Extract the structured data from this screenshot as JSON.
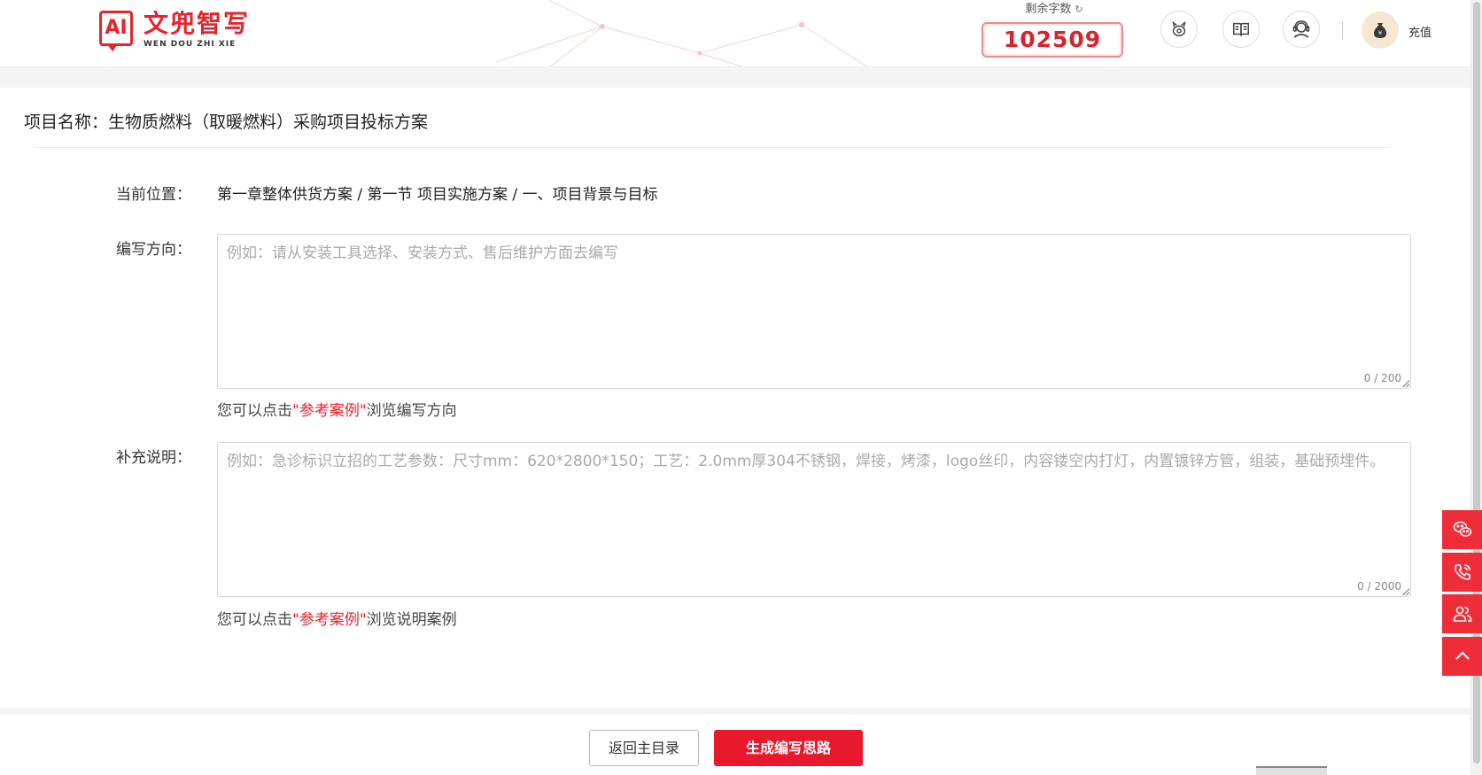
{
  "header": {
    "logo_mark": "AI",
    "logo_cn": "文兜智写",
    "logo_en": "WEN DOU ZHI XIE",
    "remaining_label": "剩余字数",
    "remaining_count": "102509",
    "recharge_label": "充值",
    "icons": [
      "piggy-bank-icon",
      "book-icon",
      "customer-service-icon",
      "money-bag-icon"
    ],
    "brand_color": "#e8232c"
  },
  "project": {
    "title": "项目名称：生物质燃料（取暖燃料）采购项目投标方案"
  },
  "form": {
    "location_label": "当前位置：",
    "location_value": "第一章整体供货方案 / 第一节 项目实施方案 / 一、项目背景与目标",
    "direction_label": "编写方向：",
    "direction_placeholder": "例如：请从安装工具选择、安装方式、售后维护方面去编写",
    "direction_counter": "0 / 200",
    "direction_hint_prefix": "您可以点击",
    "direction_hint_link": "\"参考案例\"",
    "direction_hint_suffix": "浏览编写方向",
    "supplement_label": "补充说明：",
    "supplement_placeholder": "例如：急诊标识立招的工艺参数：尺寸mm：620*2800*150；工艺：2.0mm厚304不锈钢，焊接，烤漆，logo丝印，内容镂空内打灯，内置镀锌方管，组装，基础预埋件。",
    "supplement_counter": "0 / 2000",
    "supplement_hint_prefix": "您可以点击",
    "supplement_hint_link": "\"参考案例\"",
    "supplement_hint_suffix": "浏览说明案例"
  },
  "footer": {
    "back_label": "返回主目录",
    "generate_label": "生成编写思路",
    "generate_color": "#e8192c"
  },
  "side_bar": {
    "icons": [
      "wechat-icon",
      "phone-icon",
      "group-icon",
      "back-to-top-icon"
    ],
    "color": "#ee2d39"
  }
}
